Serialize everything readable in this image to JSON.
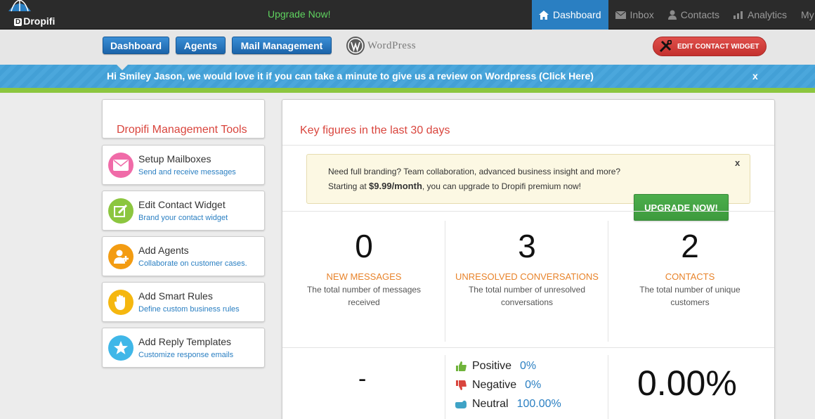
{
  "app": {
    "brand": "Dropifi",
    "brand_badge": "D",
    "upgrade_link": "Upgrade Now!"
  },
  "topnav": [
    {
      "label": "Dashboard",
      "icon": "home-icon",
      "active": true
    },
    {
      "label": "Inbox",
      "icon": "envelope-icon",
      "active": false
    },
    {
      "label": "Contacts",
      "icon": "user-icon",
      "active": false
    },
    {
      "label": "Analytics",
      "icon": "bar-chart-icon",
      "active": false
    },
    {
      "label": "My",
      "icon": "",
      "active": false
    }
  ],
  "subnav": {
    "dashboard": "Dashboard",
    "agents": "Agents",
    "mail_management": "Mail Management",
    "wordpress": "WordPress",
    "edit_contact_widget": "EDIT CONTACT WIDGET"
  },
  "banner": {
    "text": "Hi Smiley Jason, we would love it if you can take a minute to give us a review on Wordpress (Click Here)",
    "close": "x"
  },
  "sidebar": {
    "title": "Dropifi Management Tools",
    "tools": [
      {
        "title": "Setup Mailboxes",
        "subtitle": "Send and receive messages",
        "icon": "mailbox-icon",
        "color": "#f06ba8"
      },
      {
        "title": "Edit Contact Widget",
        "subtitle": "Brand your contact widget",
        "icon": "edit-icon",
        "color": "#8cc63f"
      },
      {
        "title": "Add Agents",
        "subtitle": "Collaborate on customer cases.",
        "icon": "add-agent-icon",
        "color": "#f39c12"
      },
      {
        "title": "Add Smart Rules",
        "subtitle": "Define custom business rules",
        "icon": "hand-icon",
        "color": "#f5b70f"
      },
      {
        "title": "Add Reply Templates",
        "subtitle": "Customize response emails",
        "icon": "star-icon",
        "color": "#3fb7e8"
      }
    ]
  },
  "main": {
    "title": "Key figures in the last 30 days",
    "promo": {
      "line1": "Need full branding? Team collaboration, advanced business insight and more?",
      "line2_pre": "Starting at ",
      "line2_price": "$9.99/month",
      "line2_post": ", you can upgrade to Dropifi premium now!",
      "close": "x",
      "button": "UPGRADE NOW!"
    },
    "stats": [
      {
        "value": "0",
        "label": "NEW MESSAGES",
        "desc": "The total number of messages received"
      },
      {
        "value": "3",
        "label": "UNRESOLVED CONVERSATIONS",
        "desc": "The total number of unresolved conversations"
      },
      {
        "value": "2",
        "label": "CONTACTS",
        "desc": "The total number of unique customers"
      }
    ],
    "dash": "-",
    "sentiment": [
      {
        "label": "Positive",
        "value": "0%",
        "icon": "thumbs-up-icon",
        "color": "#6fb33a"
      },
      {
        "label": "Negative",
        "value": "0%",
        "icon": "thumbs-down-icon",
        "color": "#d9453d"
      },
      {
        "label": "Neutral",
        "value": "100.00%",
        "icon": "neutral-hand-icon",
        "color": "#3fa3c6"
      }
    ],
    "big_percent": "0.00%"
  }
}
